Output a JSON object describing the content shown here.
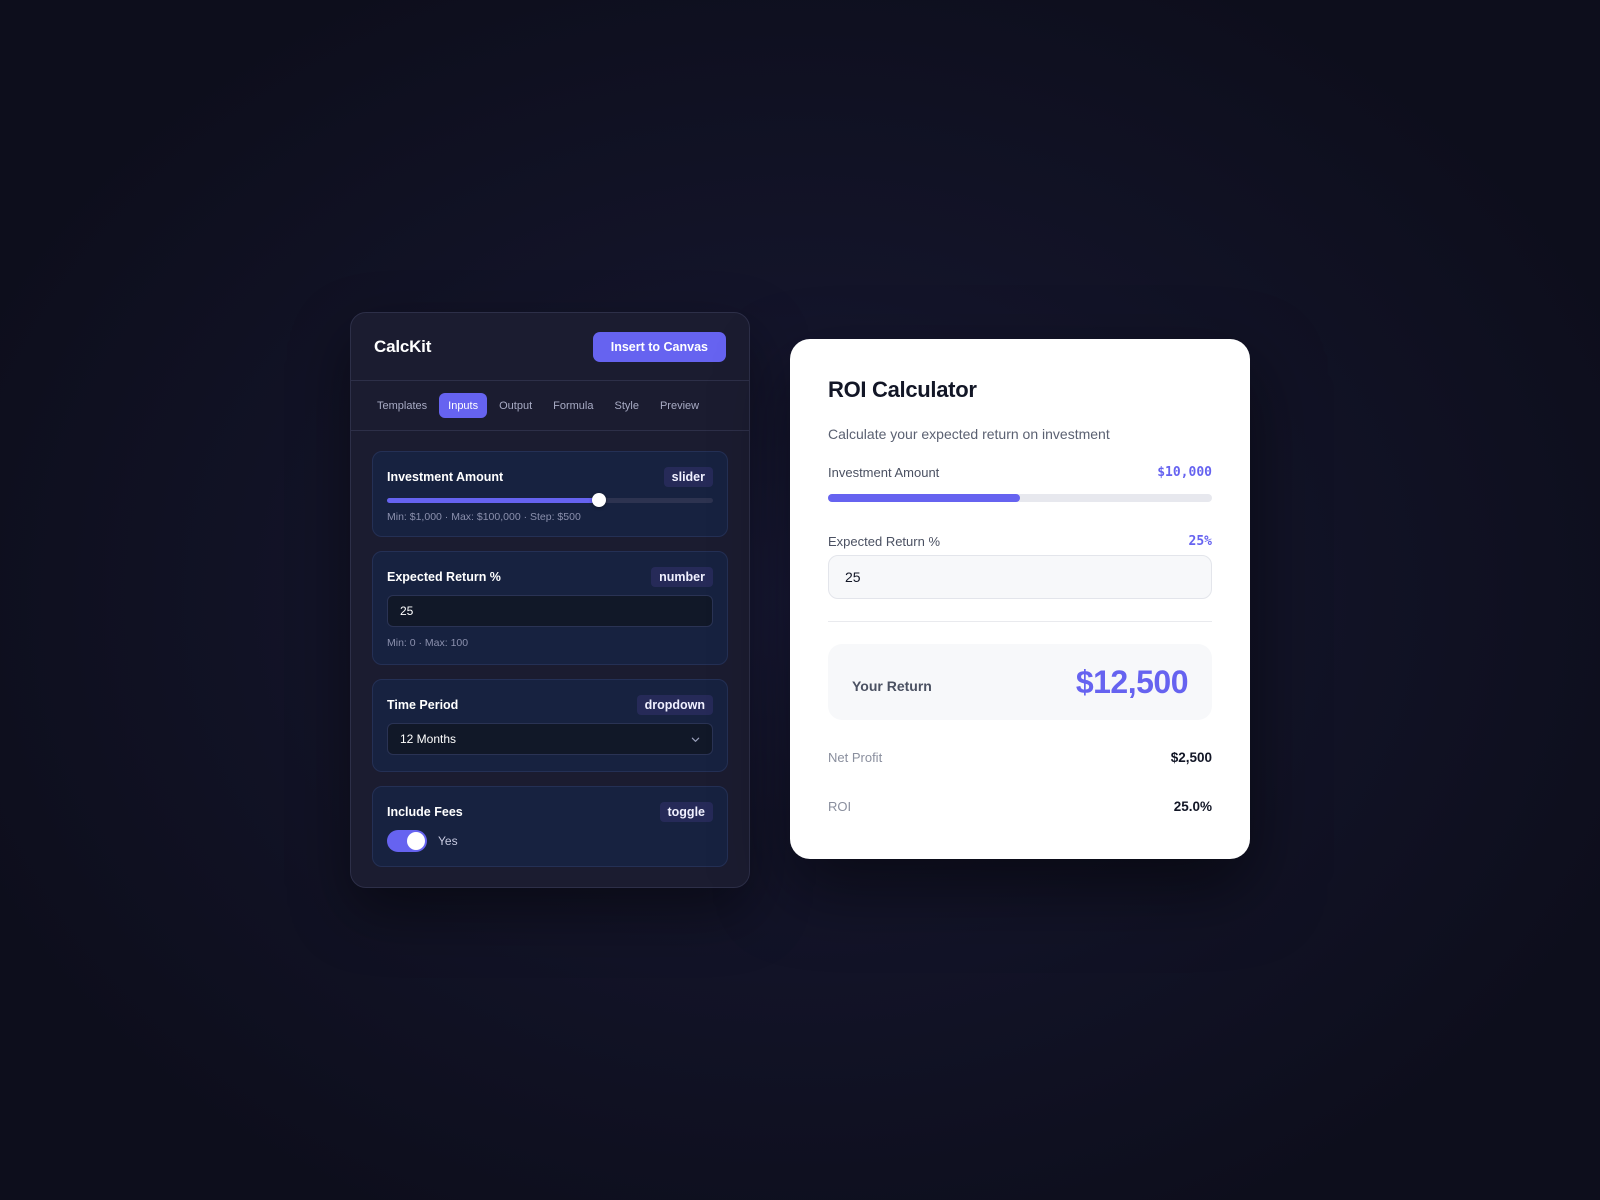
{
  "builder": {
    "brand": "CalcKit",
    "insert_label": "Insert to Canvas",
    "tabs": [
      {
        "label": "Templates",
        "active": false
      },
      {
        "label": "Inputs",
        "active": true
      },
      {
        "label": "Output",
        "active": false
      },
      {
        "label": "Formula",
        "active": false
      },
      {
        "label": "Style",
        "active": false
      },
      {
        "label": "Preview",
        "active": false
      }
    ],
    "fields": {
      "investment": {
        "title": "Investment Amount",
        "type": "slider",
        "hint": "Min: $1,000 · Max: $100,000 · Step: $500",
        "slider_fraction": 0.65
      },
      "return_pct": {
        "title": "Expected Return %",
        "type": "number",
        "value": "25",
        "hint": "Min: 0 · Max: 100"
      },
      "time_period": {
        "title": "Time Period",
        "type": "dropdown",
        "selected": "12 Months"
      },
      "fees": {
        "title": "Include Fees",
        "type": "toggle",
        "on": true,
        "state_label": "Yes"
      }
    }
  },
  "preview": {
    "title": "ROI Calculator",
    "subtitle": "Calculate your expected return on investment",
    "investment_label": "Investment Amount",
    "investment_value": "$10,000",
    "investment_fraction": 0.5,
    "return_label": "Expected Return %",
    "return_value": "25%",
    "return_input": "25",
    "result_label": "Your Return",
    "result_value": "$12,500",
    "net_profit_label": "Net Profit",
    "net_profit_value": "$2,500",
    "roi_label": "ROI",
    "roi_value": "25.0%"
  },
  "colors": {
    "accent": "#6663f0",
    "panel_bg": "#1b1c30",
    "card_bg": "#172240",
    "preview_bg": "#ffffff"
  }
}
